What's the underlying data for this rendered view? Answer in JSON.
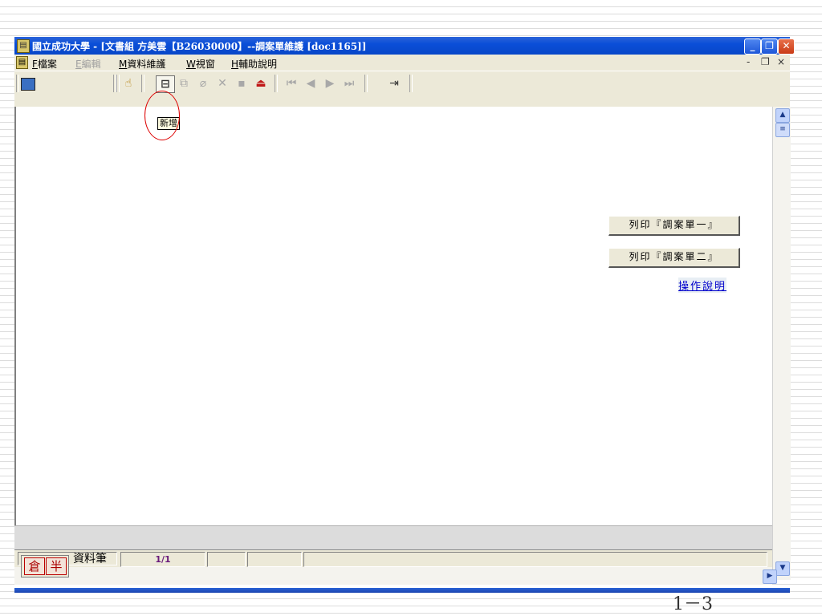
{
  "window": {
    "title": "國立成功大學 - [文書組 方美雲【B26030000】--調案單維護 [doc1165]]",
    "app_icon": "form-icon",
    "minimize": "_",
    "restore": "❐",
    "close": "✕"
  },
  "menu": [
    {
      "key": "F",
      "label": "檔案",
      "enabled": true
    },
    {
      "key": "E",
      "label": "編輯",
      "enabled": false
    },
    {
      "key": "M",
      "label": "資料維護",
      "enabled": true
    },
    {
      "key": "W",
      "label": "視窗",
      "enabled": true
    },
    {
      "key": "H",
      "label": "輔助說明",
      "enabled": true
    }
  ],
  "mdi_controls": {
    "minimize": "-",
    "restore": "❐",
    "close": "×"
  },
  "toolbar": {
    "icons": [
      "picture-icon",
      "query-icon",
      "new-record-icon",
      "copy-icon",
      "erase-icon",
      "delete-icon",
      "save-icon",
      "print-icon",
      "first-record-icon",
      "prev-record-icon",
      "next-record-icon",
      "last-record-icon",
      "exit-icon"
    ]
  },
  "tooltip": "新增",
  "buttons": {
    "print1": "列印『調案單一』",
    "print2": "列印『調案單二』",
    "help_link": "操作說明"
  },
  "statusbar": {
    "label": "資料筆",
    "record": "1/1"
  },
  "ime": {
    "first": "倉",
    "second": "半"
  },
  "slide_page": "1－3"
}
